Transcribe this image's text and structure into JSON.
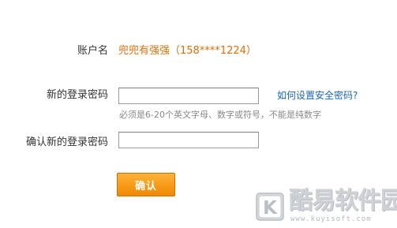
{
  "form": {
    "account_label": "账户名",
    "account_value": "兜兜有强强（158****1224）",
    "new_password_label": "新的登录密码",
    "new_password_value": "",
    "help_link": "如何设置安全密码?",
    "password_hint": "必须是6-20个英文字母、数字或符号，不能是纯数字",
    "confirm_password_label": "确认新的登录密码",
    "confirm_password_value": "",
    "confirm_button": "确认"
  },
  "watermark": {
    "title": "酷易软件园",
    "url": "www.kuyisoft.com",
    "logo_letter": "K"
  },
  "colors": {
    "account_value": "#e46e08",
    "link": "#1a66b3",
    "button": "#f79a16",
    "hint": "#888888"
  }
}
